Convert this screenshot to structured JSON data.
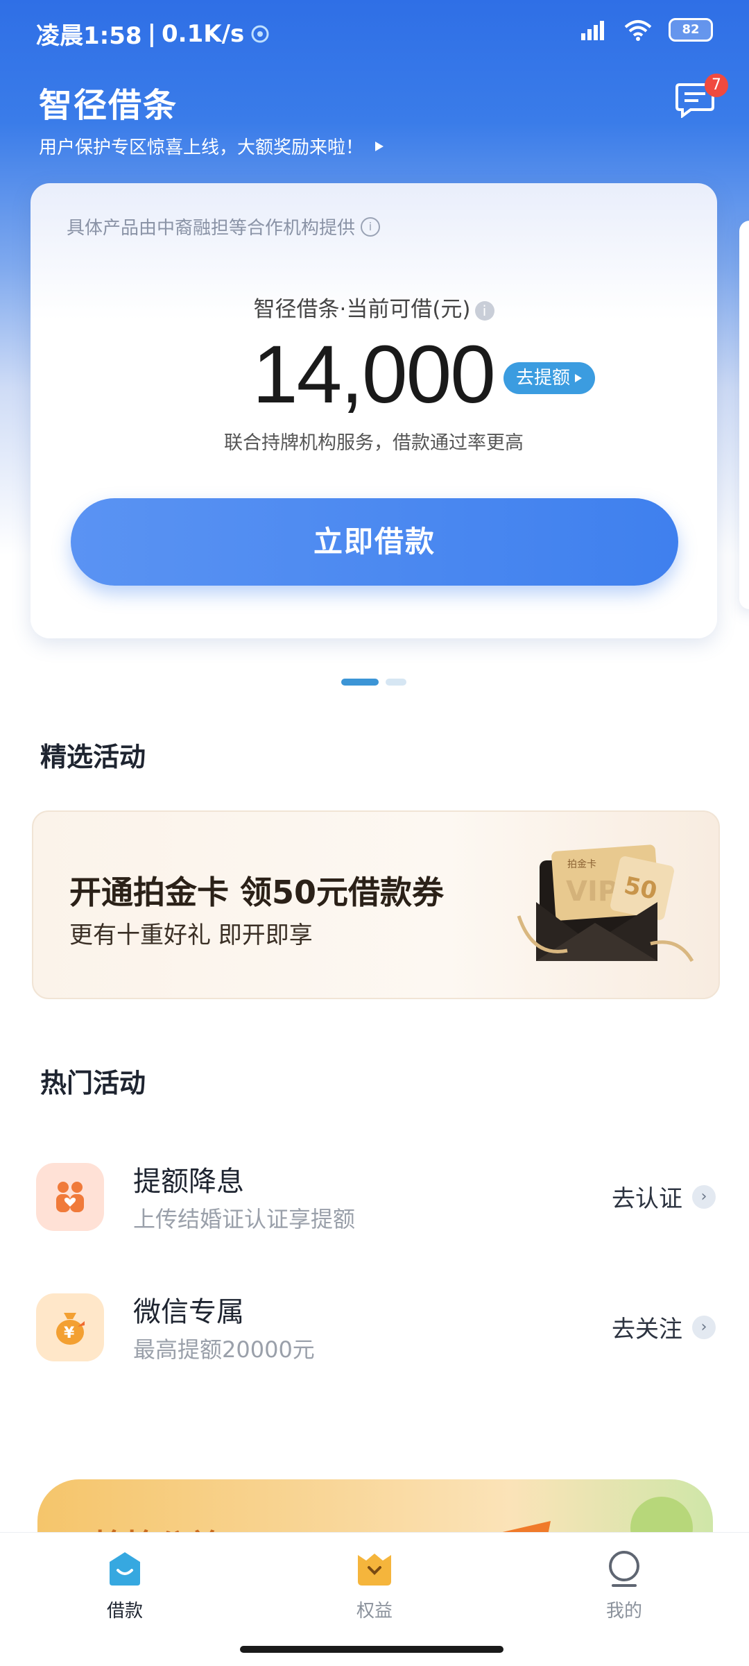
{
  "status_bar": {
    "time": "凌晨1:58",
    "network_speed": "0.1K/s",
    "battery": "82"
  },
  "header": {
    "app_title": "智径借条",
    "announcement": "用户保护专区惊喜上线，大额奖励来啦！",
    "message_badge": "7"
  },
  "card": {
    "provider_note": "具体产品由中裔融担等合作机构提供",
    "limit_label": "智径借条·当前可借(元)",
    "amount": "14,000",
    "raise_button": "去提额",
    "description": "联合持牌机构服务，借款通过率更高",
    "borrow_button": "立即借款"
  },
  "featured": {
    "section_title": "精选活动",
    "promo_title": "开通拍金卡 领50元借款券",
    "promo_subtitle": "更有十重好礼 即开即享",
    "card_label": "拍金卡",
    "vip_text": "VIP",
    "coupon_value": "50"
  },
  "hot": {
    "section_title": "热门活动",
    "items": [
      {
        "title": "提额降息",
        "subtitle": "上传结婚证认证享提额",
        "action": "去认证"
      },
      {
        "title": "微信专属",
        "subtitle": "最高提额20000元",
        "action": "去关注"
      }
    ]
  },
  "bottom_banner": {
    "text": "抢抢公益"
  },
  "tabs": [
    {
      "label": "借款",
      "icon": "loan-icon",
      "active": true
    },
    {
      "label": "权益",
      "icon": "benefits-icon",
      "active": false
    },
    {
      "label": "我的",
      "icon": "profile-icon",
      "active": false
    }
  ],
  "colors": {
    "primary_blue": "#3f80ee",
    "badge_red": "#f04a3f",
    "raise_button_blue": "#3b9ce0"
  }
}
